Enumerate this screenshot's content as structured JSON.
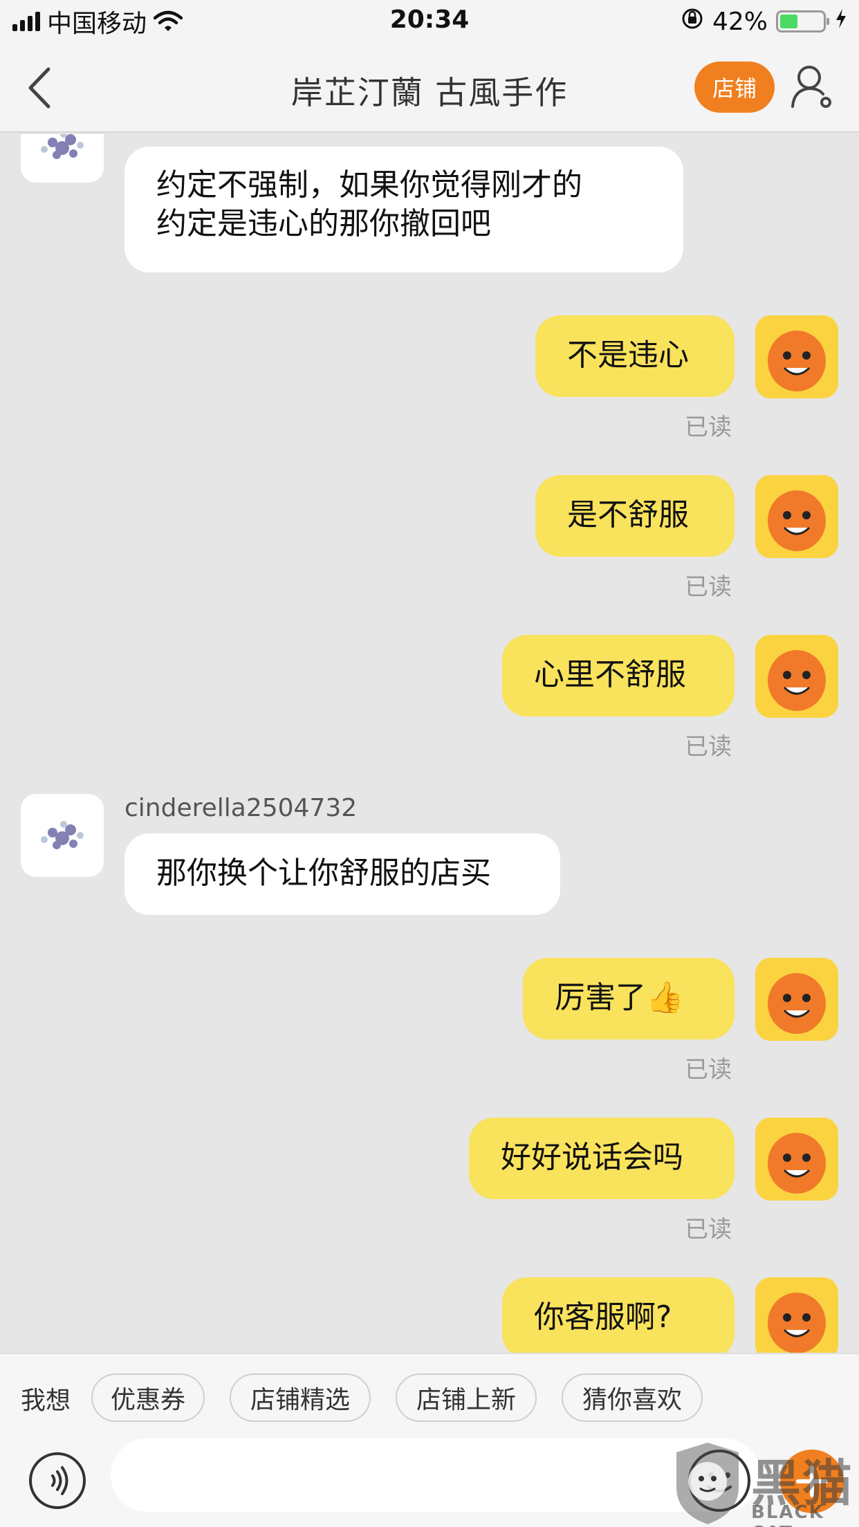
{
  "status_bar": {
    "carrier": "中国移动",
    "time": "20:34",
    "battery_percent": "42%",
    "battery_level": 0.42,
    "icons": [
      "signal-icon",
      "wifi-icon",
      "orientation-lock-icon",
      "battery-icon",
      "charging-icon"
    ]
  },
  "nav": {
    "title": "岸芷汀蘭 古風手作",
    "shop_button": "店铺",
    "icons": [
      "back-icon",
      "profile-settings-icon"
    ],
    "accent": "#f07f1f"
  },
  "messages": [
    {
      "side": "left",
      "text_lines": [
        "约定不强制，如果你觉得刚才的",
        "约定是违心的那你撤回吧"
      ]
    },
    {
      "side": "right",
      "text": "不是违心",
      "status": "已读"
    },
    {
      "side": "right",
      "text": "是不舒服",
      "status": "已读"
    },
    {
      "side": "right",
      "text": "心里不舒服",
      "status": "已读"
    },
    {
      "side": "left",
      "sender": "cinderella2504732",
      "text": "那你换个让你舒服的店买"
    },
    {
      "side": "right",
      "text": "厉害了",
      "emoji": "👍",
      "status": "已读"
    },
    {
      "side": "right",
      "text": "好好说话会吗",
      "status": "已读"
    },
    {
      "side": "right",
      "text": "你客服啊?"
    }
  ],
  "quick_bar": {
    "label": "我想",
    "chips": [
      "优惠券",
      "店铺精选",
      "店铺上新",
      "猜你喜欢"
    ]
  },
  "input": {
    "value": "",
    "icons": [
      "voice-icon",
      "emoji-icon",
      "plus-icon"
    ]
  },
  "watermark": {
    "text": "黑猫",
    "sub": "BLACK CAT"
  },
  "colors": {
    "chat_bg": "#e6e6e6",
    "my_bubble": "#f9e25c",
    "their_bubble": "#ffffff",
    "read_text": "#9a9a9a"
  }
}
